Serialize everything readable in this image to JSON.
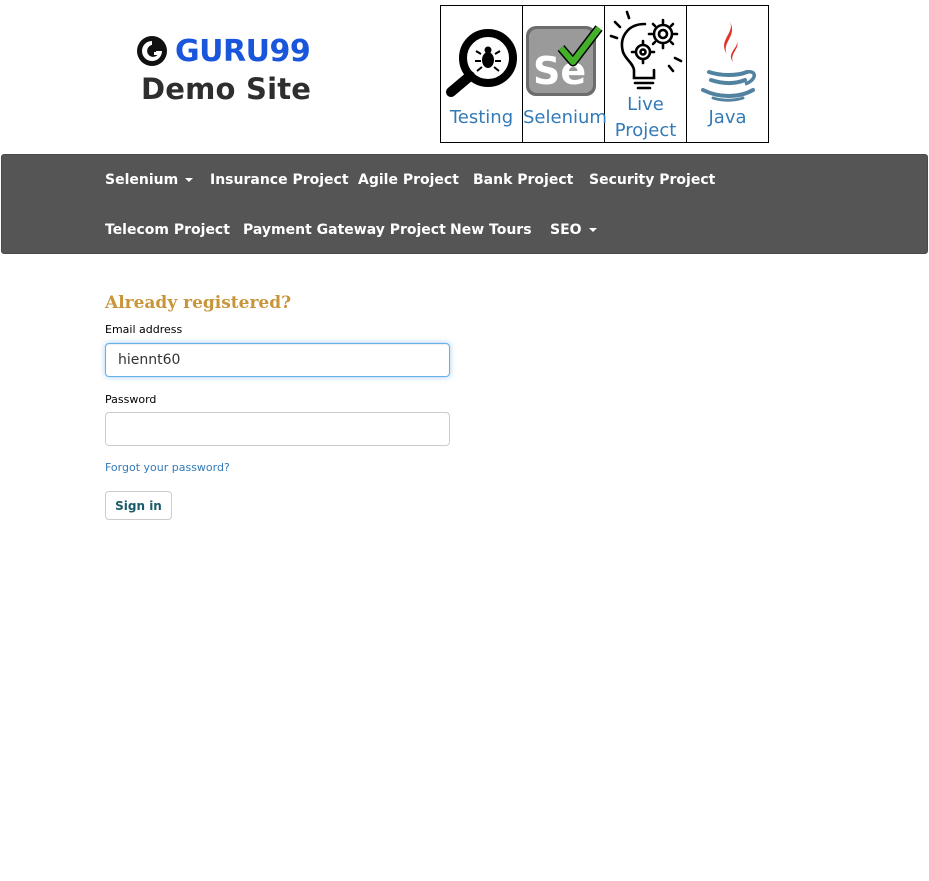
{
  "header": {
    "logo_text": "GURU99",
    "logo_subtitle": "Demo Site",
    "brand_color": "#1a56db",
    "courses": [
      {
        "label_lines": [
          "Testing"
        ],
        "icon": "magnifier-bug-icon"
      },
      {
        "label_lines": [
          "Selenium"
        ],
        "icon": "selenium-icon"
      },
      {
        "label_lines": [
          "Live",
          "Project"
        ],
        "icon": "lightbulb-gears-icon"
      },
      {
        "label_lines": [
          "Java"
        ],
        "icon": "java-icon"
      }
    ]
  },
  "nav": {
    "background": "#555555",
    "row1": [
      {
        "label": "Selenium",
        "dropdown": true
      },
      {
        "label": "Insurance Project",
        "dropdown": false
      },
      {
        "label": "Agile Project",
        "dropdown": false
      },
      {
        "label": "Bank Project",
        "dropdown": false
      },
      {
        "label": "Security Project",
        "dropdown": false
      }
    ],
    "row2": [
      {
        "label": "Telecom Project",
        "dropdown": false
      },
      {
        "label": "Payment Gateway Project",
        "dropdown": false
      },
      {
        "label": "New Tours",
        "dropdown": false
      },
      {
        "label": "SEO",
        "dropdown": true
      }
    ]
  },
  "login": {
    "title": "Already registered?",
    "title_color": "#c8953a",
    "email_label": "Email address",
    "email_value": "hiennt60",
    "password_label": "Password",
    "password_value": "",
    "forgot_link": "Forgot your password?",
    "signin_label": "Sign in"
  }
}
